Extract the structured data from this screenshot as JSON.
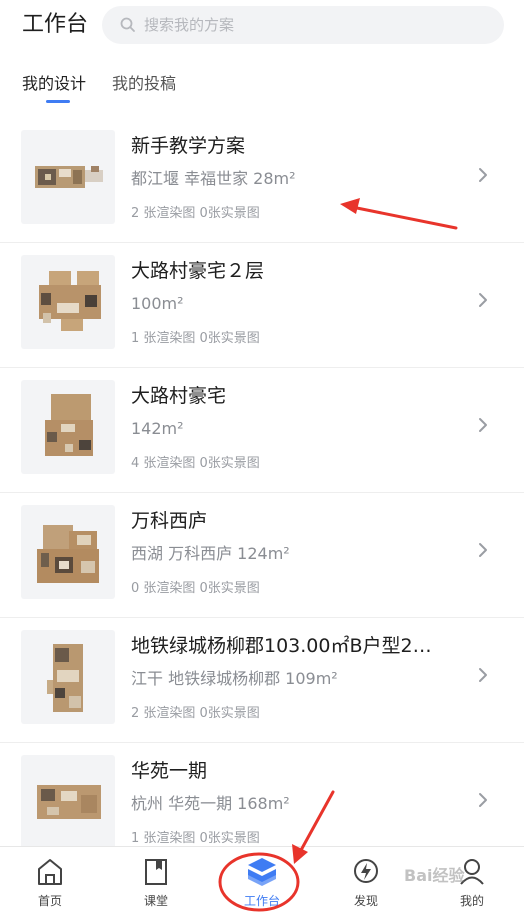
{
  "header": {
    "title": "工作台",
    "search_placeholder": "搜索我的方案"
  },
  "tabs": [
    {
      "label": "我的设计",
      "active": true
    },
    {
      "label": "我的投稿",
      "active": false
    }
  ],
  "designs": [
    {
      "title": "新手教学方案",
      "subtitle": "都江堰 幸福世家 28m²",
      "stats": "2 张渲染图  0张实景图"
    },
    {
      "title": "大路村豪宅２层",
      "subtitle": " 100m²",
      "stats": "1 张渲染图  0张实景图"
    },
    {
      "title": "大路村豪宅",
      "subtitle": " 142m²",
      "stats": "4 张渲染图  0张实景图"
    },
    {
      "title": "万科西庐",
      "subtitle": "西湖 万科西庐 124m²",
      "stats": "0 张渲染图  0张实景图"
    },
    {
      "title": "地铁绿城杨柳郡103.00㎡B户型2…",
      "subtitle": "江干 地铁绿城杨柳郡 109m²",
      "stats": "2 张渲染图  0张实景图"
    },
    {
      "title": "华苑一期",
      "subtitle": "杭州 华苑一期 168m²",
      "stats": "1 张渲染图  0张实景图"
    }
  ],
  "bottom_nav": [
    {
      "label": "首页",
      "icon": "home-icon",
      "active": false
    },
    {
      "label": "课堂",
      "icon": "book-icon",
      "active": false
    },
    {
      "label": "工作台",
      "icon": "layers-icon",
      "active": true
    },
    {
      "label": "发现",
      "icon": "lightning-icon",
      "active": false
    },
    {
      "label": "我的",
      "icon": "user-icon",
      "active": false
    }
  ],
  "colors": {
    "accent": "#3f7cf3",
    "annotation": "#e8342b",
    "text_primary": "#1f1f1f",
    "text_secondary": "#8a8d93"
  },
  "watermark": "Bai经验"
}
